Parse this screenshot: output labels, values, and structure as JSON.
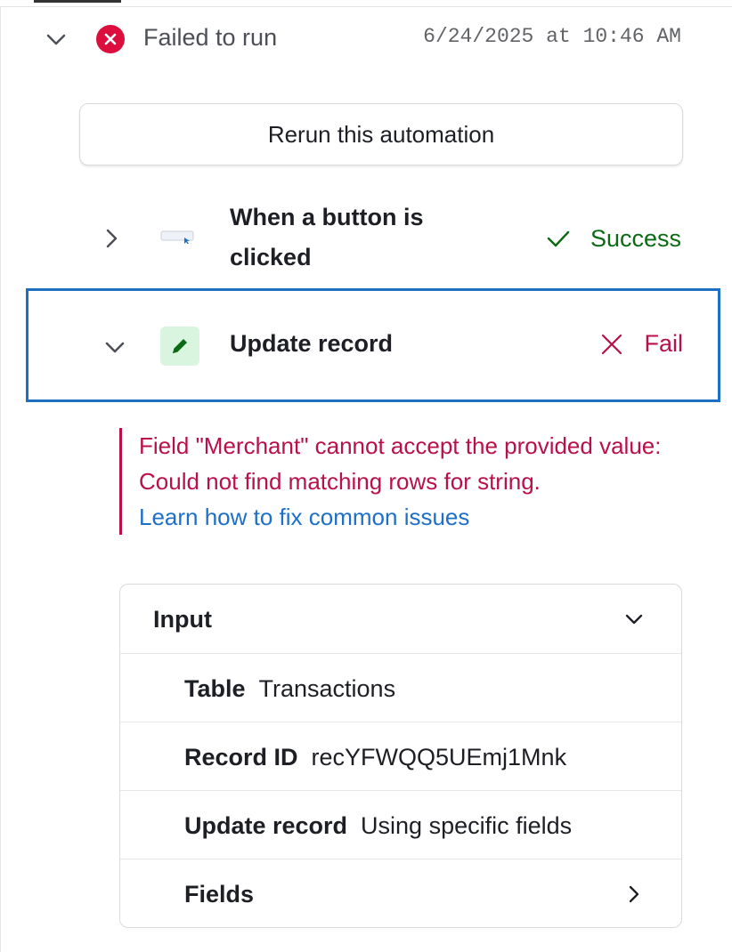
{
  "run": {
    "status": "Failed to run",
    "timestamp": "6/24/2025 at 10:46 AM",
    "rerun_label": "Rerun this automation"
  },
  "trigger": {
    "title": "When a button is clicked",
    "status": "Success",
    "icon": "button-click-icon"
  },
  "action": {
    "title": "Update record",
    "status": "Fail",
    "icon": "pencil-icon",
    "error_message": "Field \"Merchant\" cannot accept the provided value: Could not find matching rows for string.",
    "help_link": "Learn how to fix common issues"
  },
  "input": {
    "heading": "Input",
    "rows": [
      {
        "label": "Table",
        "value": "Transactions"
      },
      {
        "label": "Record ID",
        "value": "recYFWQQ5UEmj1Mnk"
      },
      {
        "label": "Update record",
        "value": "Using specific fields"
      },
      {
        "label": "Fields",
        "value": ""
      }
    ]
  },
  "colors": {
    "fail": "#dc0e3d",
    "fail_text": "#b81048",
    "success": "#0a6b14",
    "link": "#1e6fc6",
    "selected_border": "#1e6fc6",
    "pencil_bg": "#d9f5df"
  }
}
